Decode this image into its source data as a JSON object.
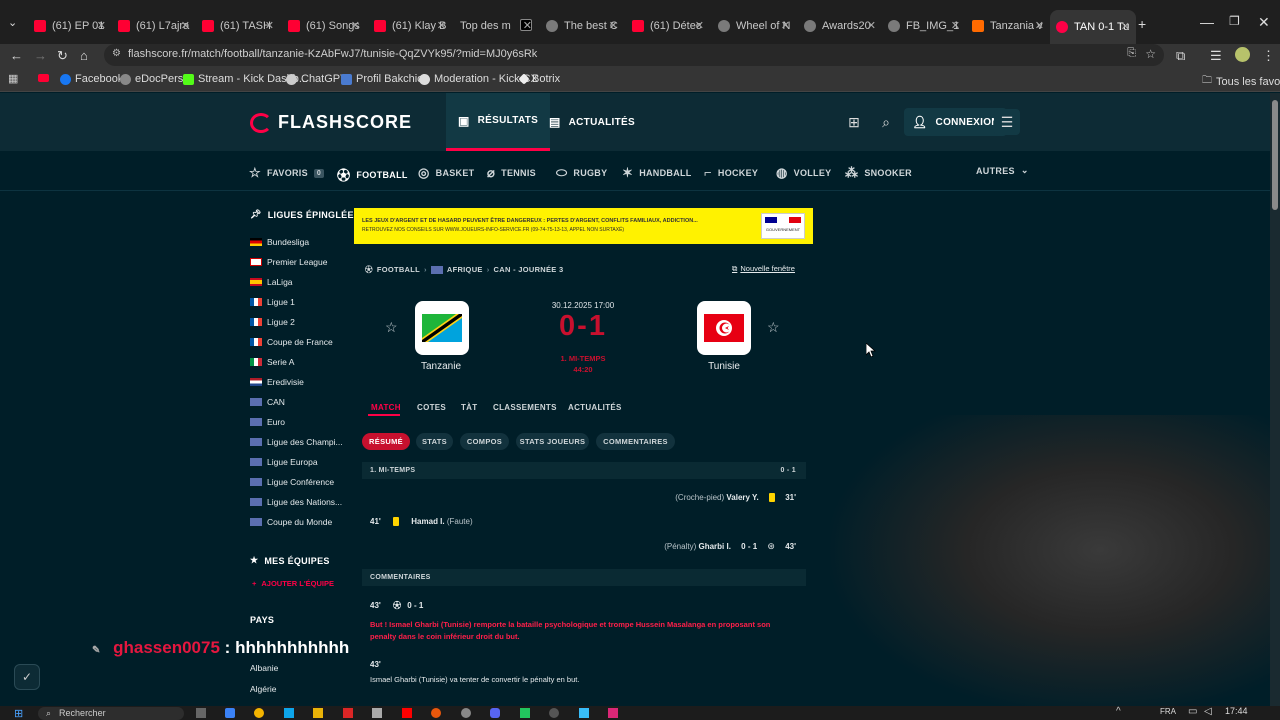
{
  "browser": {
    "tabs": [
      {
        "title": "(61) EP 01",
        "icon": "youtube-icon"
      },
      {
        "title": "(61) L7ajra",
        "icon": "youtube-icon"
      },
      {
        "title": "(61) TASH",
        "icon": "youtube-icon"
      },
      {
        "title": "(61) Songs",
        "icon": "youtube-icon"
      },
      {
        "title": "(61) Klay B",
        "icon": "youtube-icon"
      },
      {
        "title": "Top des m",
        "icon": "x-icon"
      },
      {
        "title": "The best C",
        "icon": "web-icon"
      },
      {
        "title": "(61) Détec",
        "icon": "youtube-icon"
      },
      {
        "title": "Wheel of N",
        "icon": "web-icon"
      },
      {
        "title": "Awards20",
        "icon": "web-icon"
      },
      {
        "title": "FB_IMG_1",
        "icon": "web-icon"
      },
      {
        "title": "Tanzania v",
        "icon": "web-icon"
      },
      {
        "title": "TAN 0-1 Tu",
        "icon": "flashscore-icon"
      }
    ],
    "url": "flashscore.fr/match/football/tanzanie-KzAbFwJ7/tunisie-QqZVYk95/?mid=MJ0y6sRk",
    "bookmarks": [
      "Facebook",
      "eDocPerso",
      "Stream - Kick Dashb...",
      "ChatGPT",
      "Profil Bakchich",
      "Moderation - Kick.CX",
      "Botrix"
    ],
    "all_bookmarks": "Tous les favoris"
  },
  "header": {
    "logo": "FLASHSCORE",
    "nav": [
      "RÉSULTATS",
      "ACTUALITÉS"
    ],
    "login": "CONNEXION"
  },
  "sports": {
    "favorites": "FAVORIS",
    "favorites_count": "0",
    "items": [
      "FOOTBALL",
      "BASKET",
      "TENNIS",
      "RUGBY",
      "HANDBALL",
      "HOCKEY",
      "VOLLEY",
      "SNOOKER"
    ],
    "more": "AUTRES"
  },
  "sidebar": {
    "pinned_title": "LIGUES ÉPINGLÉES",
    "leagues": [
      "Bundesliga",
      "Premier League",
      "LaLiga",
      "Ligue 1",
      "Ligue 2",
      "Coupe de France",
      "Serie A",
      "Eredivisie",
      "CAN",
      "Euro",
      "Ligue des Champi...",
      "Ligue Europa",
      "Ligue Conférence",
      "Ligue des Nations...",
      "Coupe du Monde"
    ],
    "teams_title": "MES ÉQUIPES",
    "add_team": "AJOUTER L'ÉQUIPE",
    "countries_title": "PAYS",
    "countries": [
      "Albanie",
      "Algérie"
    ]
  },
  "banner": {
    "text": "LES JEUX D'ARGENT ET DE HASARD PEUVENT ÊTRE DANGEREUX : PERTES D'ARGENT, CONFLITS FAMILIAUX, ADDICTION...",
    "subtext": "RETROUVEZ NOS CONSEILS SUR WWW.JOUEURS-INFO-SERVICE.FR (09-74-75-13-13, APPEL NON SURTAXÉ)",
    "gov": "GOUVERNEMENT"
  },
  "match": {
    "breadcrumb": [
      "FOOTBALL",
      "AFRIQUE",
      "CAN - JOURNÉE 3"
    ],
    "new_window": "Nouvelle fenêtre",
    "home": "Tanzanie",
    "away": "Tunisie",
    "datetime": "30.12.2025 17:00",
    "score": "0-1",
    "status": "1. MI-TEMPS",
    "clock": "44:20",
    "tabs": [
      "MATCH",
      "COTES",
      "TÀT",
      "CLASSEMENTS",
      "ACTUALITÉS"
    ],
    "subtabs": [
      "RÉSUMÉ",
      "STATS",
      "COMPOS",
      "STATS JOUEURS",
      "COMMENTAIRES"
    ]
  },
  "summary": {
    "period": "1. MI-TEMPS",
    "period_score": "0 - 1",
    "events": [
      {
        "minute": "31'",
        "player": "Valery Y.",
        "detail": "(Croche-pied)",
        "side": "away"
      },
      {
        "minute": "41'",
        "player": "Hamad I.",
        "detail": "(Faute)",
        "side": "home"
      },
      {
        "minute": "43'",
        "player": "Gharbi I.",
        "detail": "(Pénalty)",
        "score": "0 - 1",
        "side": "away"
      }
    ]
  },
  "commentary": {
    "title": "COMMENTAIRES",
    "items": [
      {
        "minute": "43'",
        "score": "0 - 1",
        "text": "But ! Ismael Gharbi (Tunisie) remporte la bataille psychologique et trompe Hussein Masalanga en proposant son penalty dans le coin inférieur droit du but."
      },
      {
        "minute": "43'",
        "text": "Ismael Gharbi (Tunisie) va tenter de convertir le pénalty en but."
      }
    ]
  },
  "chat": {
    "user": "ghassen0075",
    "separator": ":",
    "message": "hhhhhhhhhhh"
  },
  "taskbar": {
    "search": "Rechercher",
    "lang": "FRA",
    "time": "17:44"
  }
}
